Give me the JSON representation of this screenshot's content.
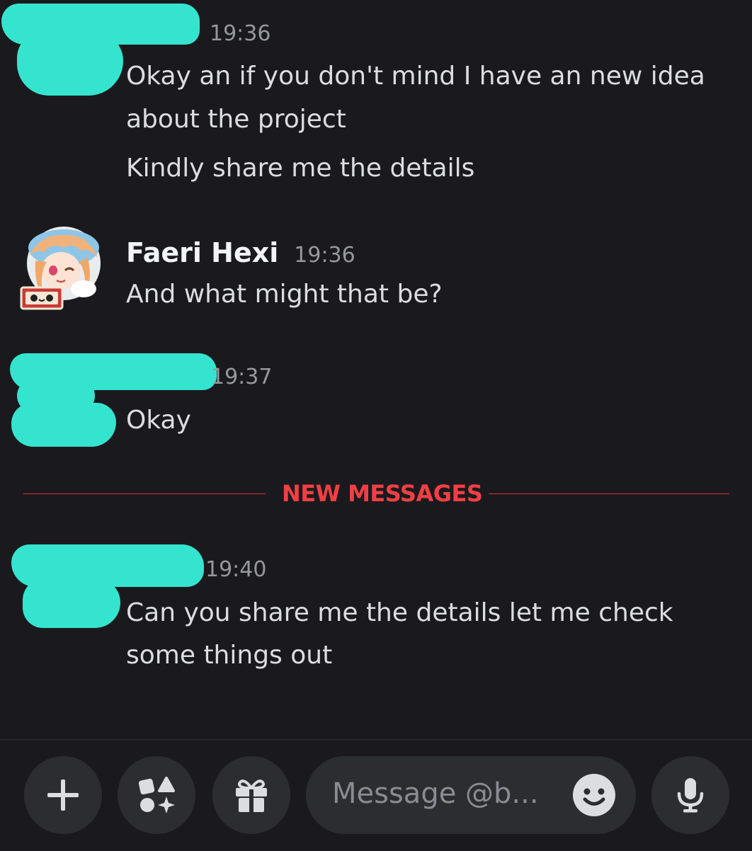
{
  "messages": [
    {
      "author": "",
      "time": "19:36",
      "lines": [
        "Okay an if you don't mind I have an new idea",
        "about the project"
      ]
    },
    {
      "author": "",
      "time": "",
      "lines": [
        "Kindly share me the details"
      ]
    },
    {
      "author": "Faeri Hexi",
      "time": "19:36",
      "lines": [
        "And what might that be?"
      ]
    },
    {
      "author": "",
      "time": "19:37",
      "lines": [
        "Okay"
      ]
    },
    {
      "author": "",
      "time": "19:40",
      "lines": [
        "Can you share me the details let me check",
        "some things out"
      ]
    }
  ],
  "divider": {
    "label": "NEW MESSAGES"
  },
  "composer": {
    "placeholder": "Message @b...",
    "buttons": {
      "add": "plus-icon",
      "apps": "apps-icon",
      "gift": "gift-icon",
      "emoji": "emoji-icon",
      "voice": "microphone-icon"
    }
  },
  "colors": {
    "background": "#1a1a1e",
    "redaction": "#35e4cf",
    "new_messages": "#f23f43",
    "button_bg": "#2b2d31"
  }
}
